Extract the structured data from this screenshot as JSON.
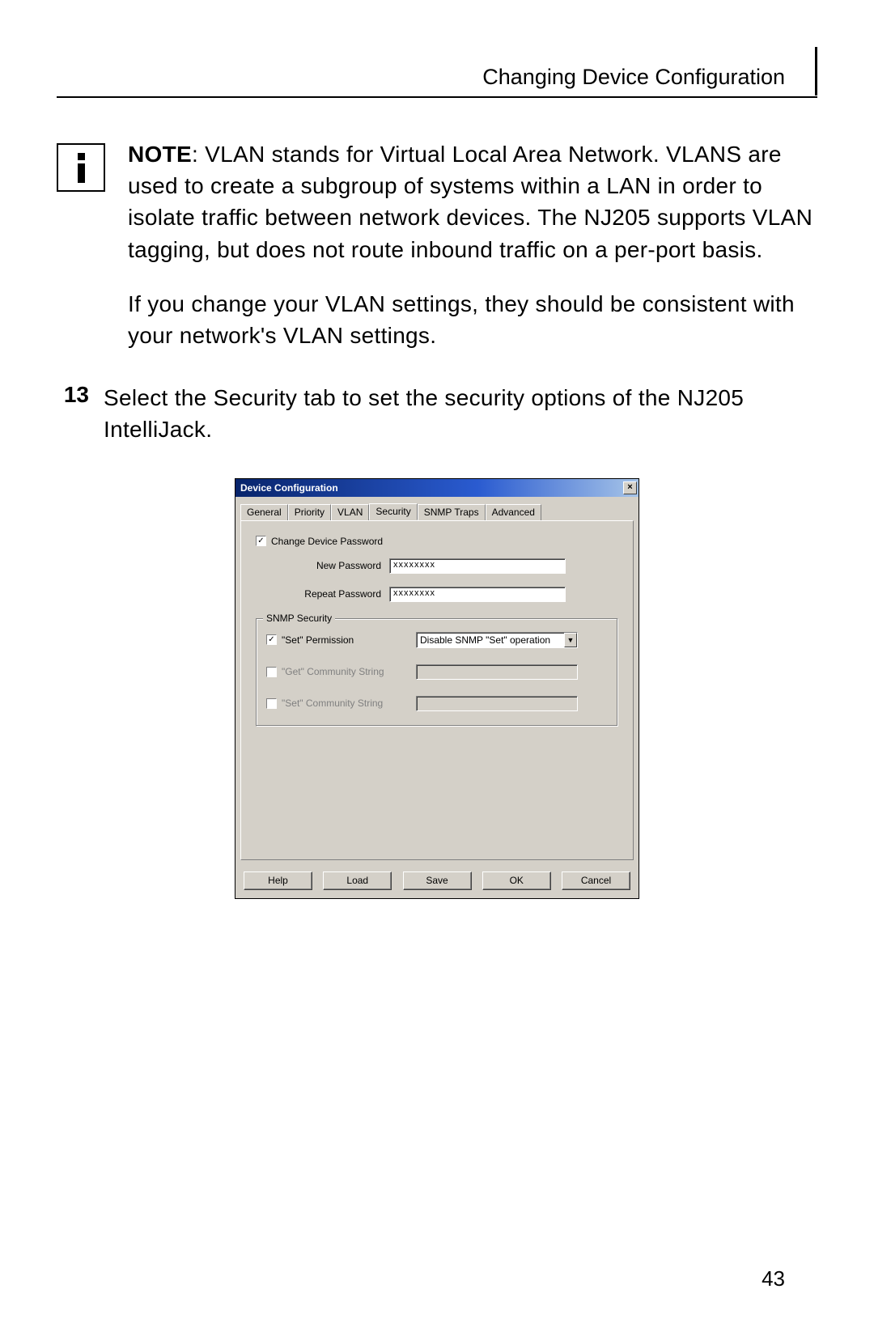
{
  "header": {
    "title": "Changing Device Configuration"
  },
  "note": {
    "label": "NOTE",
    "para1": ": VLAN stands for Virtual Local Area Network. VLANS are used to create a subgroup of systems within a LAN in order to isolate traffic between network devices. The NJ205 supports VLAN tagging, but does not route inbound traffic on a per-port basis.",
    "para2": "If you change your VLAN settings, they should be consistent with your network's VLAN settings."
  },
  "step": {
    "num": "13",
    "text": "Select the Security tab to set the security options of the NJ205 IntelliJack."
  },
  "dialog": {
    "title": "Device Configuration",
    "close": "×",
    "tabs": [
      "General",
      "Priority",
      "VLAN",
      "Security",
      "SNMP Traps",
      "Advanced"
    ],
    "active_tab": "Security",
    "change_pw": {
      "checked": "✓",
      "label": "Change Device Password",
      "new_label": "New Password",
      "new_value": "xxxxxxxx",
      "repeat_label": "Repeat Password",
      "repeat_value": "xxxxxxxx"
    },
    "snmp": {
      "legend": "SNMP Security",
      "set_perm": {
        "checked": "✓",
        "label": "\"Set\" Permission",
        "value": "Disable SNMP \"Set\" operation"
      },
      "get_comm": {
        "checked": "",
        "label": "\"Get\" Community String",
        "value": ""
      },
      "set_comm": {
        "checked": "",
        "label": "\"Set\" Community String",
        "value": ""
      }
    },
    "buttons": {
      "help": "Help",
      "load": "Load",
      "save": "Save",
      "ok": "OK",
      "cancel": "Cancel"
    }
  },
  "page_number": "43"
}
